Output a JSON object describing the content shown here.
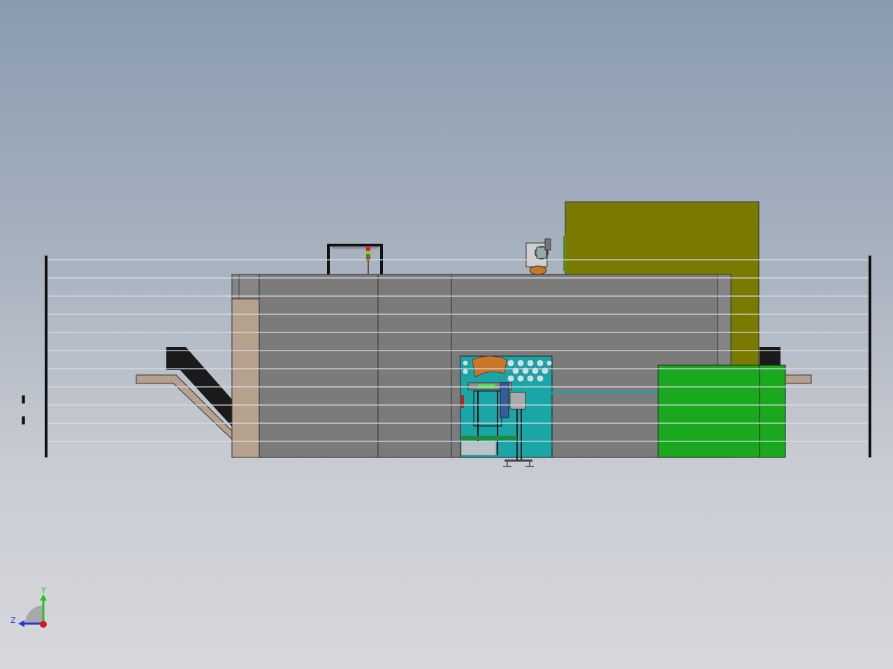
{
  "view": {
    "background_top": "#8a9bb0",
    "background_bottom": "#d7d8dd"
  },
  "model": {
    "colors": {
      "enclosure": "#7b7b7b",
      "enclosure_edge": "#3a3a3a",
      "side_panel": "#b5a18e",
      "tower": "#7a7a00",
      "green_unit": "#19a81e",
      "conveyor_dark": "#1a1a1a",
      "conveyor_tan": "#b5a18e",
      "cell_teal": "#1aa6a6",
      "robot_orange": "#c8772a",
      "fence_post": "#111111",
      "fence_wire": "#d8dde4"
    }
  },
  "triad": {
    "y_label": "Y",
    "z_label": "Z",
    "y_color": "#1ec81e",
    "z_color": "#1e3cd2",
    "origin_color": "#d01e1e"
  }
}
